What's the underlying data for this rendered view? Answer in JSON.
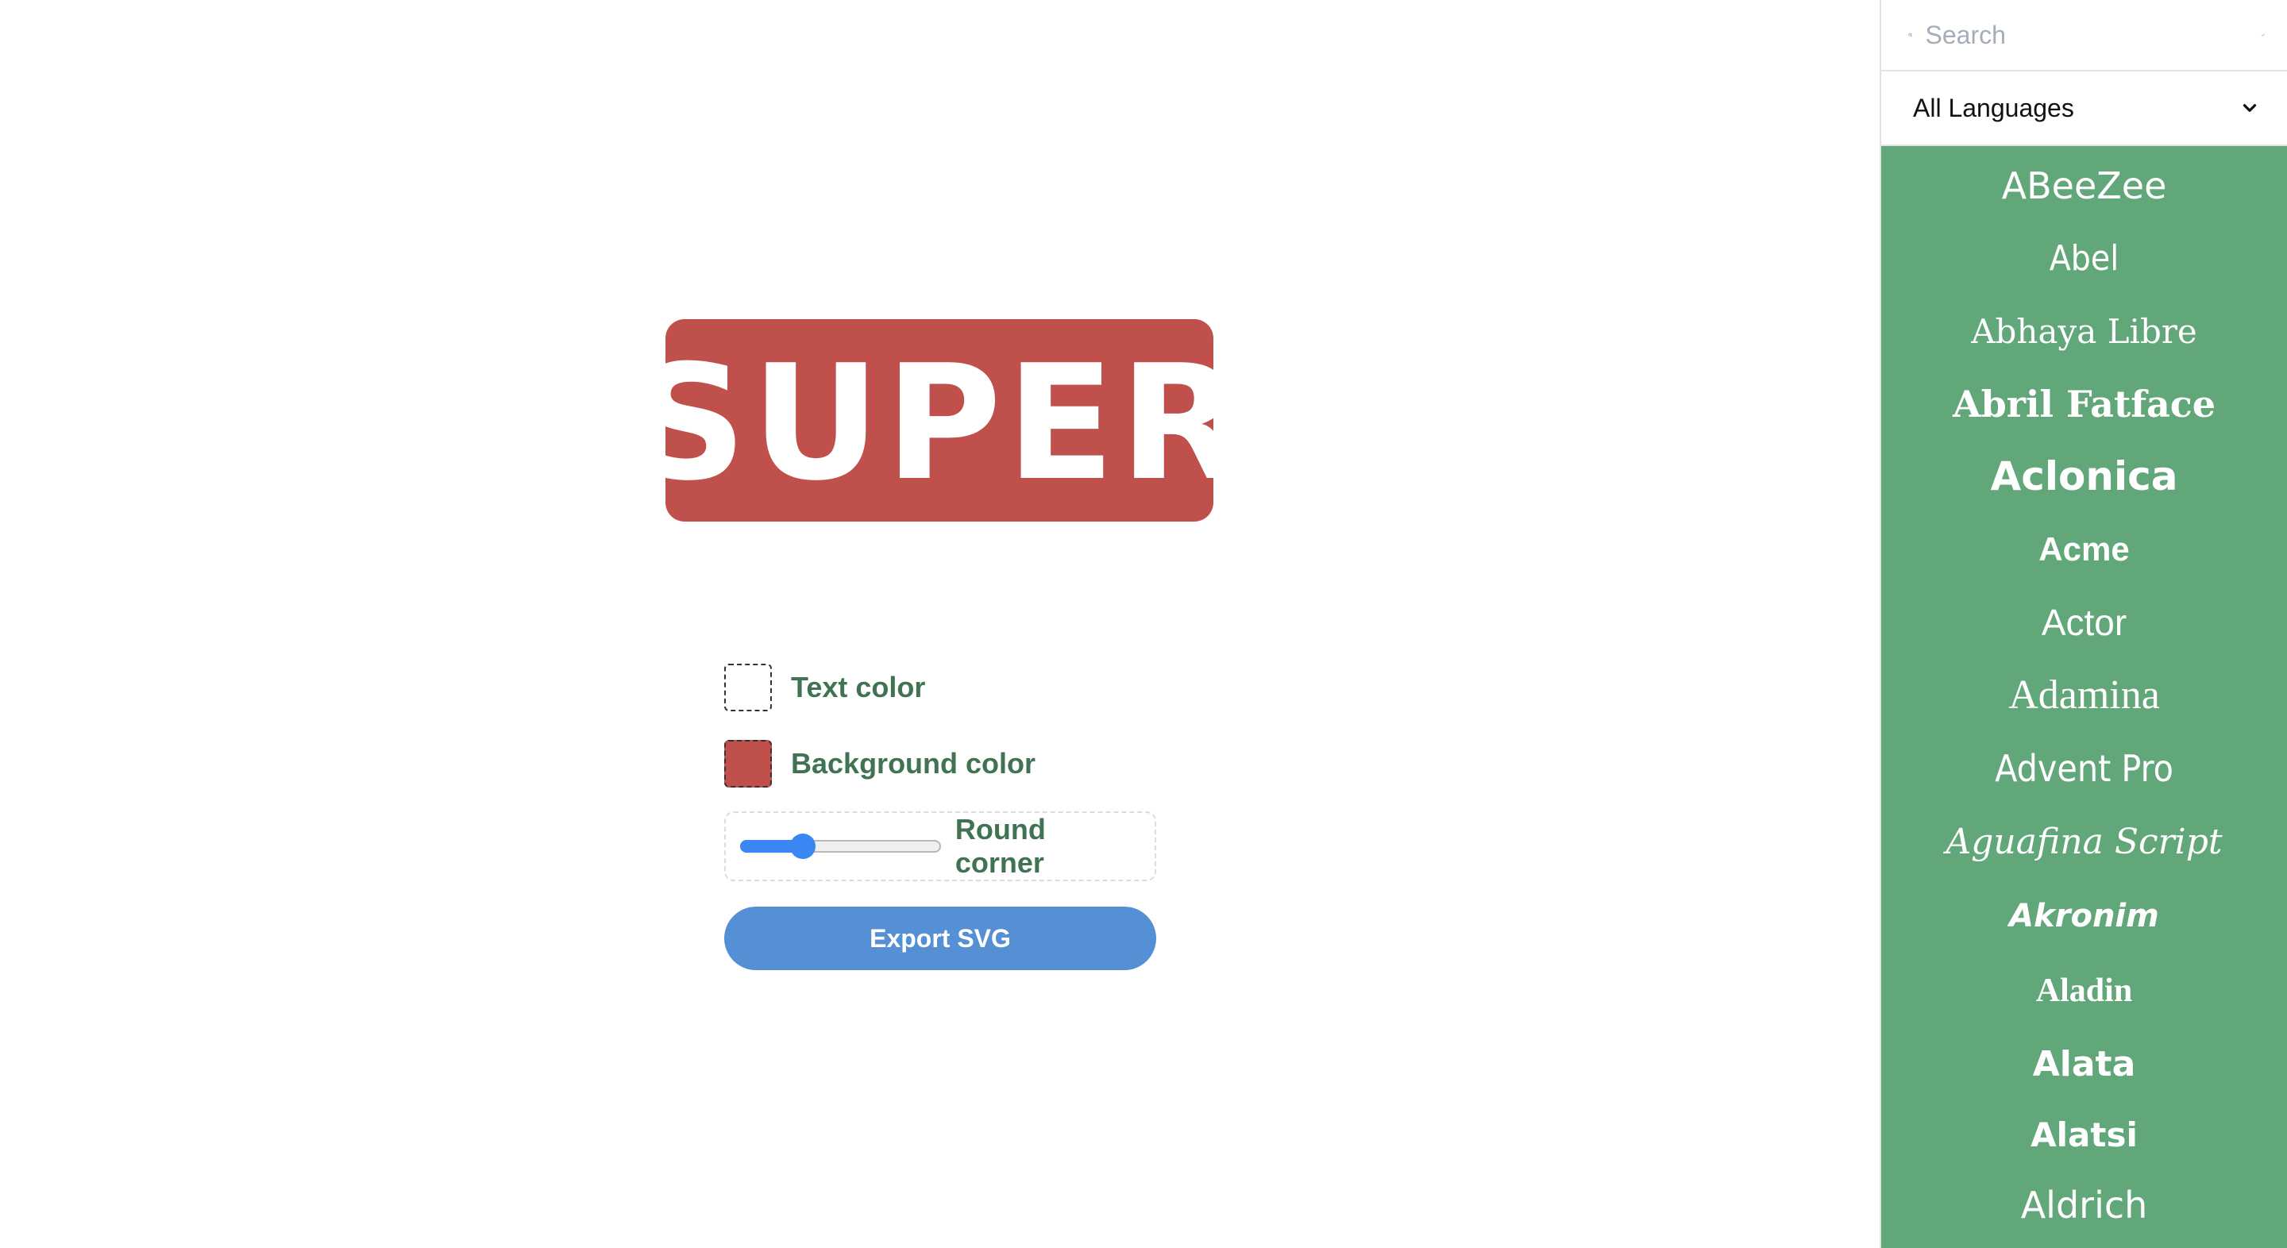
{
  "preview": {
    "text": "SUPER",
    "text_color": "#ffffff",
    "background_color": "#c0504c"
  },
  "controls": {
    "text_color_label": "Text color",
    "text_color_value": "#ffffff",
    "background_color_label": "Background color",
    "background_color_value": "#c0504c",
    "round_corner_label": "Round corner",
    "round_corner_level": 0.3,
    "export_label": "Export SVG"
  },
  "sidebar": {
    "search_placeholder": "Search",
    "language_selected": "All Languages",
    "list_background": "#62a77a",
    "fonts": [
      "ABeeZee",
      "Abel",
      "Abhaya Libre",
      "Abril Fatface",
      "Aclonica",
      "Acme",
      "Actor",
      "Adamina",
      "Advent Pro",
      "Aguafina Script",
      "Akronim",
      "Aladin",
      "Alata",
      "Alatsi",
      "Aldrich"
    ]
  },
  "colors": {
    "accent_blue": "#5490d3",
    "label_green": "#3f7352",
    "slider_blue": "#3a86f2"
  }
}
